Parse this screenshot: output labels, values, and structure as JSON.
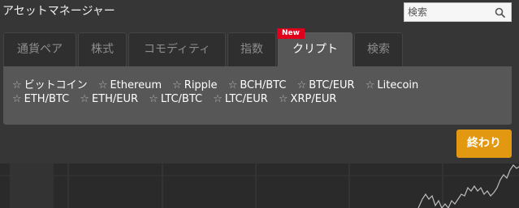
{
  "window": {
    "title": "アセットマネージャー"
  },
  "search": {
    "placeholder": "検索",
    "icon": "search-icon"
  },
  "tabs": [
    {
      "label": "通貨ペア"
    },
    {
      "label": "株式"
    },
    {
      "label": "コモディティ"
    },
    {
      "label": "指数"
    },
    {
      "label": "クリプト",
      "active": true,
      "badge": "New"
    },
    {
      "label": "検索"
    }
  ],
  "crypto": {
    "row1": [
      "ビットコイン",
      "Ethereum",
      "Ripple",
      "BCH/BTC",
      "BTC/EUR",
      "Litecoin"
    ],
    "row2": [
      "ETH/BTC",
      "ETH/EUR",
      "LTC/BTC",
      "LTC/EUR",
      "XRP/EUR"
    ]
  },
  "footer": {
    "close_label": "終わり"
  },
  "colors": {
    "accent": "#e39812",
    "badge": "#e0001b",
    "panel": "#363636",
    "active_tab": "#575757"
  }
}
